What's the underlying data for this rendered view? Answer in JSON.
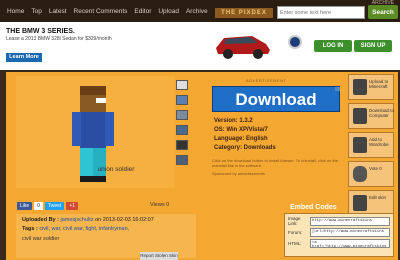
{
  "nav": {
    "items": [
      "Home",
      "Top",
      "Latest",
      "Recent Comments",
      "Editor",
      "Upload",
      "Archive"
    ],
    "logo": "THE PIXDEX",
    "search_placeholder": "Enter some text here",
    "search_button": "Search",
    "top_links": "ARCHIVE"
  },
  "ad": {
    "title": "THE BMW 3 SERIES.",
    "sub": "Lease a 2013 BMW 328i Sedan for $329/month",
    "learn_more": "Learn More"
  },
  "auth": {
    "login": "LOG IN",
    "signup": "SIGN UP"
  },
  "skin": {
    "name": "union soldier",
    "views_label": "Views",
    "views_count": "0",
    "uploaded_label": "Uploaded By :",
    "uploader": "jamesjschultz",
    "date": "on 2013-02-03 16:02:07",
    "tags_label": "Tags :",
    "tags": "civil, war, civil war, fight, infantryman,",
    "comment": "civil war soldier",
    "report": "Report Stolen Skin"
  },
  "social": {
    "like": "Like",
    "like_count": "0",
    "tweet": "Tweet",
    "plus": "+1"
  },
  "download": {
    "advert_label": "ADVERTISEMENT",
    "button": "Download",
    "version": "Version: 1.3.2",
    "os": "OS: Win XP/Vista/7",
    "language": "Language: English",
    "category": "Category: Downloads",
    "disclaimer": "Click on the download button to install Adware. To uninstall, click on the uninstall link in the software.",
    "sponsored": "Sponsored by advertisements"
  },
  "side_buttons": [
    {
      "icon": "upload-icon",
      "label": "Upload to Minecraft"
    },
    {
      "icon": "computer-download-icon",
      "label": "Download to Computer"
    },
    {
      "icon": "wardrobe-icon",
      "label": "Add to Wardrobe"
    },
    {
      "icon": "heart-icon",
      "label": "Vote 0"
    },
    {
      "icon": "edit-icon",
      "label": "Edit skin"
    }
  ],
  "embed": {
    "title": "Embed Codes",
    "rows": [
      {
        "label": "Image Link:",
        "value": "http://www.minecraftskins"
      },
      {
        "label": "Forum:",
        "value": "[url=http://www.minecraftskins"
      },
      {
        "label": "HTML:",
        "value": "<a href='http://www.minecraftskins"
      }
    ]
  },
  "colors": {
    "main_bg": "#f4a832",
    "download_blue": "#1f6fc6",
    "nav_bg": "#2a1d12",
    "button_green": "#3c8f2b"
  }
}
